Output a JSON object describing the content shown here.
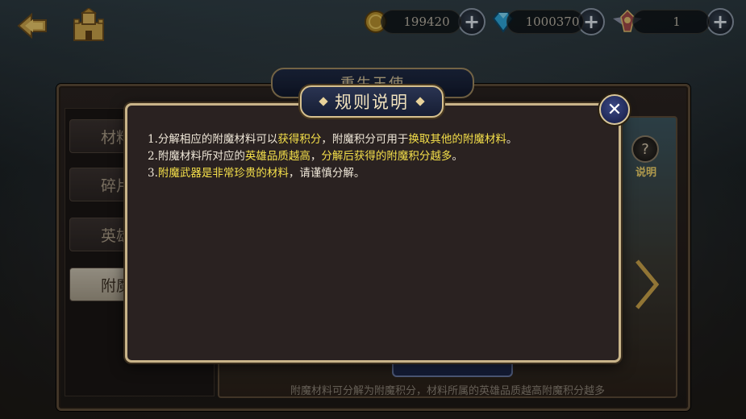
{
  "resources": {
    "gold": {
      "value": "199420",
      "icon": "gold-coin-icon"
    },
    "diamond": {
      "value": "1000370",
      "icon": "diamond-icon"
    },
    "emblem": {
      "value": "1",
      "icon": "winged-emblem-icon"
    }
  },
  "main_window": {
    "title": "重生王使",
    "tabs": [
      {
        "label": "材料",
        "active": false
      },
      {
        "label": "碎片",
        "active": false
      },
      {
        "label": "英雄",
        "active": false
      },
      {
        "label": "附魔",
        "active": true
      }
    ],
    "help_label": "说明",
    "bottom_hint": "附魔材料可分解为附魔积分，材料所属的英雄品质越高附魔积分越多"
  },
  "dialog": {
    "title": "规则说明",
    "rules": [
      {
        "num": "1.",
        "parts": [
          {
            "text": "分解相应的附魔材料可以",
            "hl": false
          },
          {
            "text": "获得积分",
            "hl": true
          },
          {
            "text": "，附魔积分可用于",
            "hl": false
          },
          {
            "text": "换取其他的附魔材料",
            "hl": true
          },
          {
            "text": "。",
            "hl": false
          }
        ]
      },
      {
        "num": "2.",
        "parts": [
          {
            "text": "附魔材料所对应的",
            "hl": false
          },
          {
            "text": "英雄品质越高",
            "hl": true
          },
          {
            "text": "，",
            "hl": false
          },
          {
            "text": "分解后获得的附魔积分越多",
            "hl": true
          },
          {
            "text": "。",
            "hl": false
          }
        ]
      },
      {
        "num": "3.",
        "parts": [
          {
            "text": "附魔武器是非常珍贵的材料",
            "hl": true
          },
          {
            "text": "，请谨慎分解。",
            "hl": false
          }
        ]
      }
    ]
  },
  "colors": {
    "highlight": "#f5e04a",
    "text": "#efe7d8",
    "frame_gold": "#c9b489",
    "dialog_bg": "#2a2221"
  }
}
